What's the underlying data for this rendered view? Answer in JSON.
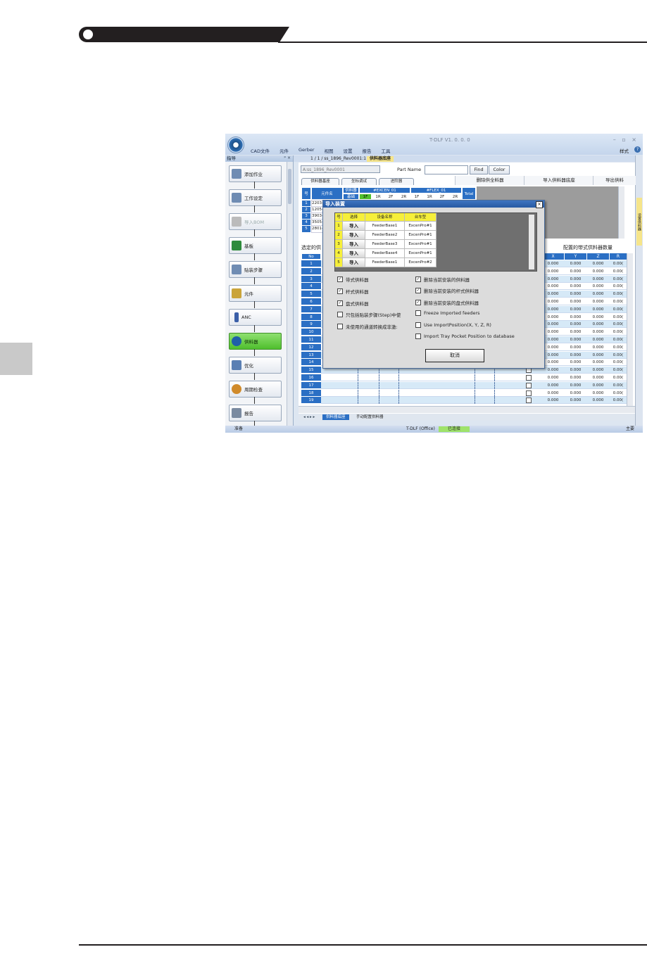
{
  "app": {
    "title": "T-DLF V1. 0. 0. 0",
    "menu": [
      "CAD文件",
      "元件",
      "Gerber",
      "视图",
      "设置",
      "报告",
      "工具"
    ],
    "style_label": "样式"
  },
  "left_panel": {
    "title": "指导",
    "items": [
      {
        "label": "添加作业"
      },
      {
        "label": "工作设定"
      },
      {
        "label": "导入BOM"
      },
      {
        "label": "基板"
      },
      {
        "label": "贴装步骤"
      },
      {
        "label": "元件"
      },
      {
        "label": "ANC"
      },
      {
        "label": "供料器"
      },
      {
        "label": "优化"
      },
      {
        "label": "周期检查"
      },
      {
        "label": "报告"
      }
    ]
  },
  "doc_tabs": [
    "1 / 1 / ss_1896_Rev0001:1",
    "供料器底座"
  ],
  "right_toolbar_label": "设置供料器",
  "toolbar": {
    "combo_value": "A:ss_1896_Rev0001",
    "part_name_label": "Part Name",
    "find_label": "Find",
    "color_label": "Color"
  },
  "subtabs": [
    "供料器基座",
    "坐标调试",
    "进阶器"
  ],
  "actions": [
    "删除供全料器",
    "导入供料器底座",
    "导出供料"
  ],
  "upper_grid": {
    "header_no": "号",
    "header_part": "元件名",
    "header_feeder": "供料器",
    "header_base": "基础",
    "excen": "#EXCEN_01",
    "flex": "#FLEX_01",
    "slots": [
      "1F",
      "1R",
      "2F",
      "2R",
      "1F",
      "1R",
      "2F",
      "2R"
    ],
    "total": "Total",
    "rows": [
      {
        "no": "1",
        "part": "2203-("
      },
      {
        "no": "2",
        "part": "1205-("
      },
      {
        "no": "3",
        "part": "3903-("
      },
      {
        "no": "4",
        "part": "3505-("
      },
      {
        "no": "5",
        "part": "2801-("
      }
    ]
  },
  "section_labels": {
    "selected": "选定的供",
    "configured": "配置的带式供料器数量"
  },
  "lower_grid": {
    "no_header": "No",
    "xyz_headers": [
      "X",
      "Y",
      "Z",
      "R"
    ],
    "rows": [
      {
        "no": "1",
        "x": "0.000",
        "y": "0.000",
        "z": "0.000",
        "r": "0.00("
      },
      {
        "no": "2",
        "x": "0.000",
        "y": "0.000",
        "z": "0.000",
        "r": "0.00("
      },
      {
        "no": "3",
        "x": "0.000",
        "y": "0.000",
        "z": "0.000",
        "r": "0.00("
      },
      {
        "no": "4",
        "x": "0.000",
        "y": "0.000",
        "z": "0.000",
        "r": "0.00("
      },
      {
        "no": "5",
        "x": "0.000",
        "y": "0.000",
        "z": "0.000",
        "r": "0.00("
      },
      {
        "no": "6",
        "x": "0.000",
        "y": "0.000",
        "z": "0.000",
        "r": "0.00("
      },
      {
        "no": "7",
        "x": "0.000",
        "y": "0.000",
        "z": "0.000",
        "r": "0.00("
      },
      {
        "no": "8",
        "x": "0.000",
        "y": "0.000",
        "z": "0.000",
        "r": "0.00("
      },
      {
        "no": "9",
        "x": "0.000",
        "y": "0.000",
        "z": "0.000",
        "r": "0.00("
      },
      {
        "no": "10",
        "x": "0.000",
        "y": "0.000",
        "z": "0.000",
        "r": "0.00("
      },
      {
        "no": "11",
        "x": "0.000",
        "y": "0.000",
        "z": "0.000",
        "r": "0.00("
      },
      {
        "no": "12",
        "x": "0.000",
        "y": "0.000",
        "z": "0.000",
        "r": "0.00("
      },
      {
        "no": "13",
        "x": "0.000",
        "y": "0.000",
        "z": "0.000",
        "r": "0.00("
      },
      {
        "no": "14",
        "x": "0.000",
        "y": "0.000",
        "z": "0.000",
        "r": "0.00("
      },
      {
        "no": "15",
        "x": "0.000",
        "y": "0.000",
        "z": "0.000",
        "r": "0.00("
      },
      {
        "no": "16",
        "x": "0.000",
        "y": "0.000",
        "z": "0.000",
        "r": "0.00("
      },
      {
        "no": "17",
        "x": "0.000",
        "y": "0.000",
        "z": "0.000",
        "r": "0.00("
      },
      {
        "no": "18",
        "x": "0.000",
        "y": "0.000",
        "z": "0.000",
        "r": "0.00("
      },
      {
        "no": "19",
        "x": "0.000",
        "y": "0.000",
        "z": "0.000",
        "r": "0.00("
      }
    ]
  },
  "bottom_tabs": [
    "供料器底座",
    "手动配置供料器"
  ],
  "status": {
    "ready": "准备",
    "app": "T-DLF (Office)",
    "connection": "已连接",
    "right": "主要"
  },
  "dialog": {
    "title": "导入装置",
    "headers": {
      "no": "号",
      "select": "选择",
      "device": "设备名称",
      "cart": "台车型"
    },
    "rows": [
      {
        "no": "1",
        "btn": "导入",
        "device": "FeederBase1",
        "cart": "ExcenPro#1"
      },
      {
        "no": "2",
        "btn": "导入",
        "device": "FeederBase2",
        "cart": "ExcenPro#1"
      },
      {
        "no": "3",
        "btn": "导入",
        "device": "FeederBase3",
        "cart": "ExcenPro#1"
      },
      {
        "no": "4",
        "btn": "导入",
        "device": "FeederBase4",
        "cart": "ExcenPro#1"
      },
      {
        "no": "5",
        "btn": "导入",
        "device": "FeederBase1",
        "cart": "ExcenPro#2"
      }
    ],
    "left_options": [
      {
        "label": "带式供料器",
        "checked": true
      },
      {
        "label": "杆式供料器",
        "checked": true
      },
      {
        "label": "盘式供料器",
        "checked": true
      },
      {
        "label": "只包括贴装步骤(Step)中使",
        "checked": false
      },
      {
        "label": "未使用的通道转换成非激:",
        "checked": false
      }
    ],
    "right_options": [
      {
        "label": "删除当前安装的供料器",
        "checked": true
      },
      {
        "label": "删除当前安装的杆式供料器",
        "checked": true
      },
      {
        "label": "删除当前安装的盘式供料器",
        "checked": true
      },
      {
        "label": "Freeze Imported feeders",
        "checked": false
      },
      {
        "label": "Use ImportPosition(X, Y, Z, R)",
        "checked": false
      },
      {
        "label": "Import Tray Pocket Position to database",
        "checked": false
      }
    ],
    "cancel_label": "取消",
    "check_mark": "✓"
  },
  "colors": {
    "accent_blue": "#2b6fc4",
    "active_green": "#4fbf2d",
    "header_yellow": "#f6ef3a"
  }
}
